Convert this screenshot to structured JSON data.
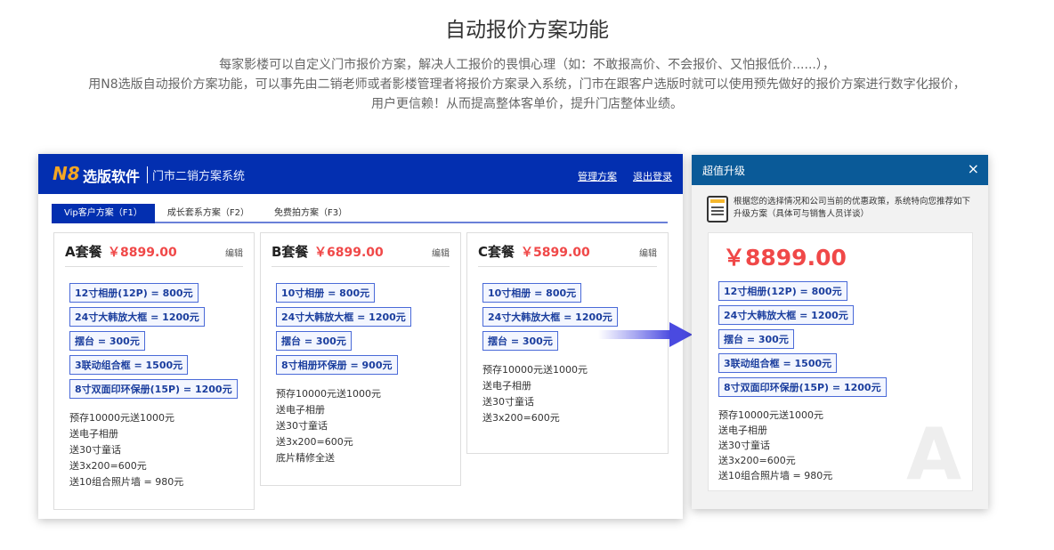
{
  "title": "自动报价方案功能",
  "intro": [
    "每家影楼可以自定义门市报价方案，解决人工报价的畏惧心理（如：不敢报高价、不会报价、又怕报低价......），",
    "用N8选版自动报价方案功能，可以事先由二销老师或者影楼管理者将报价方案录入系统，门市在跟客户选版时就可以使用预先做好的报价方案进行数字化报价，",
    "用户更信赖！从而提高整体客单价，提升门店整体业绩。"
  ],
  "app": {
    "logo": "N8",
    "brand": "选版软件",
    "subtitle": "门市二销方案系统",
    "links": [
      "管理方案",
      "退出登录"
    ],
    "tabs": [
      "Vip客户方案（F1）",
      "成长套系方案（F2）",
      "免费拍方案（F3）"
    ],
    "edit": "编辑",
    "packages": [
      {
        "name": "A套餐",
        "price": "￥8899.00",
        "items": [
          "12寸相册(12P) = 800元",
          "24寸大韩放大框 = 1200元",
          "摆台 = 300元",
          "3联动组合框 = 1500元",
          "8寸双面印环保册(15P) = 1200元"
        ],
        "gifts": [
          "预存10000元送1000元",
          "送电子相册",
          "送30寸童话",
          "送3x200=600元",
          "送10组合照片墙 = 980元"
        ]
      },
      {
        "name": "B套餐",
        "price": "￥6899.00",
        "items": [
          "10寸相册 = 800元",
          "24寸大韩放大框 = 1200元",
          "摆台 = 300元",
          "8寸相册环保册 = 900元"
        ],
        "gifts": [
          "预存10000元送1000元",
          "送电子相册",
          "送30寸童话",
          "送3x200=600元",
          "底片精修全送"
        ]
      },
      {
        "name": "C套餐",
        "price": "￥5899.00",
        "items": [
          "10寸相册 = 800元",
          "24寸大韩放大框 = 1200元",
          "摆台 = 300元"
        ],
        "gifts": [
          "预存10000元送1000元",
          "送电子相册",
          "送30寸童话",
          "送3x200=600元"
        ]
      }
    ]
  },
  "dialog": {
    "title": "超值升级",
    "close": "×",
    "message": "根据您的选择情况和公司当前的优惠政策，系统特向您推荐如下升级方案（具体可与销售人员详谈）",
    "price": "￥8899.00",
    "items": [
      "12寸相册(12P) = 800元",
      "24寸大韩放大框 = 1200元",
      "摆台 = 300元",
      "3联动组合框 = 1500元",
      "8寸双面印环保册(15P) = 1200元"
    ],
    "gifts": [
      "预存10000元送1000元",
      "送电子相册",
      "送30寸童话",
      "送3x200=600元",
      "送10组合照片墙 = 980元"
    ],
    "watermark": "A"
  }
}
